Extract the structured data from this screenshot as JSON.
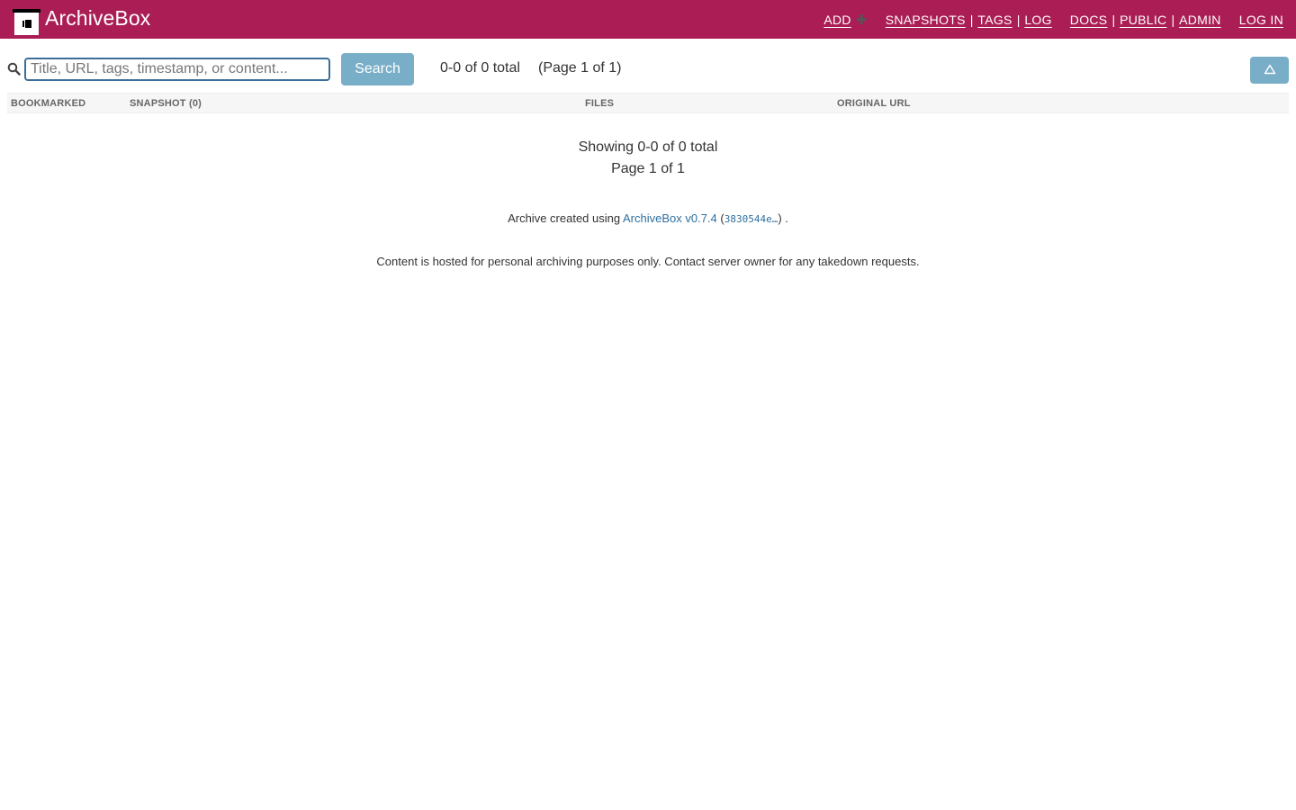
{
  "header": {
    "brand": "ArchiveBox",
    "color": "#aa1e55",
    "nav": {
      "add": "ADD",
      "snapshots": "SNAPSHOTS",
      "tags": "TAGS",
      "log": "LOG",
      "docs": "DOCS",
      "public": "PUBLIC",
      "admin": "ADMIN",
      "login": "LOG IN",
      "separator": "|"
    }
  },
  "toolbar": {
    "search_placeholder": "Title, URL, tags, timestamp, or content...",
    "search_value": "",
    "search_button": "Search",
    "count": "0-0 of 0 total",
    "page": "(Page 1 of 1)",
    "button_color": "#79aec8"
  },
  "table": {
    "columns": [
      "BOOKMARKED",
      "SNAPSHOT (0)",
      "FILES",
      "ORIGINAL URL"
    ]
  },
  "empty": {
    "showing": "Showing 0-0 of 0 total",
    "page": "Page 1 of 1"
  },
  "footer": {
    "created_prefix": "Archive created using",
    "version_link": "ArchiveBox v0.7.4",
    "commit": "3830544e…",
    "open_paren": "(",
    "close_paren": ") .",
    "notice": "Content is hosted for personal archiving purposes only. Contact server owner for any takedown requests."
  }
}
